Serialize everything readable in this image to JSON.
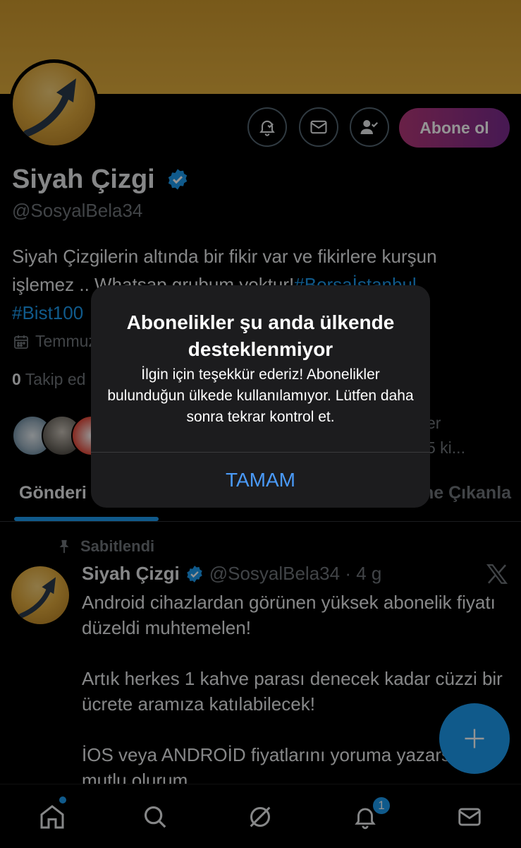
{
  "profile": {
    "name": "Siyah Çizgi",
    "handle": "@SosyalBela34",
    "subscribe_label": "Abone ol",
    "bio_line1": "Siyah Çizgilerin altında bir fikir var ve fikirlere kurşun",
    "bio_line2_prefix": "işlemez .. Whatsap grubum yoktur!",
    "bio_tag1": "#Borsaİstanbul",
    "bio_tag2": "#Bist100",
    "joined": "Temmuz",
    "following_count": "0",
    "following_label": "Takip ed",
    "followers_text1": "er",
    "followers_text2": "5 ki..."
  },
  "tabs": {
    "posts": "Gönderi",
    "highlights": "ne Çıkanla"
  },
  "pinned": {
    "label": "Sabitlendi",
    "name": "Siyah Çizgi",
    "handle_time": "@SosyalBela34 · 4 g",
    "para1": "Android cihazlardan görünen yüksek abonelik fiyatı düzeldi muhtemelen!",
    "para2": "Artık herkes 1 kahve parası denecek kadar cüzzi bir ücrete aramıza katılabilecek!",
    "para3": "İOS veya ANDROİD fiyatlarını yoruma yazarsanız mutlu olurum"
  },
  "nav": {
    "notification_count": "1"
  },
  "alert": {
    "title": "Abonelikler şu anda ülkende desteklenmiyor",
    "message": "İlgin için teşekkür ederiz! Abonelikler bulunduğun ülkede kullanılamıyor. Lütfen daha sonra tekrar kontrol et.",
    "button": "TAMAM"
  },
  "colors": {
    "accent": "#1d9bf0",
    "banner": "#d9a437",
    "subscribe_gradient_start": "#b5387a",
    "subscribe_gradient_end": "#7a2b8f",
    "alert_button": "#4a9af8"
  },
  "icons": {
    "notify_button": "bell-check-icon",
    "message_button": "envelope-icon",
    "follow_button": "person-check-icon",
    "verified": "verified-badge-icon",
    "calendar": "calendar-icon",
    "pin": "pin-icon",
    "x_logo": "x-logo-icon",
    "fab": "plus-icon",
    "nav": [
      "home-icon",
      "search-icon",
      "grok-icon",
      "bell-icon",
      "mail-icon"
    ]
  }
}
